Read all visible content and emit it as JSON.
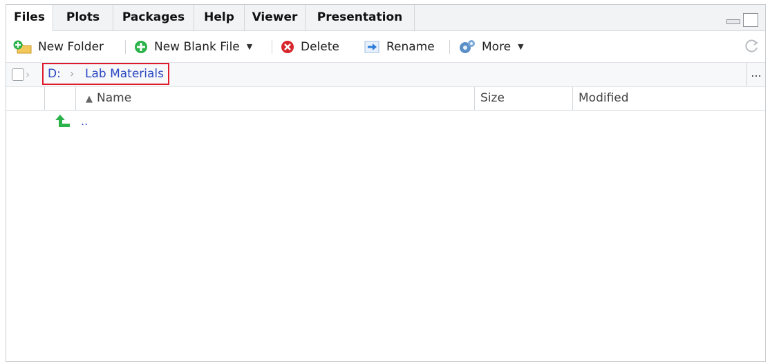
{
  "tabs": [
    {
      "label": "Files",
      "active": true
    },
    {
      "label": "Plots"
    },
    {
      "label": "Packages"
    },
    {
      "label": "Help"
    },
    {
      "label": "Viewer"
    },
    {
      "label": "Presentation"
    }
  ],
  "toolbar": {
    "new_folder": "New Folder",
    "new_blank_file": "New Blank File",
    "delete": "Delete",
    "rename": "Rename",
    "more": "More"
  },
  "breadcrumb": {
    "items": [
      "D:",
      "Lab Materials"
    ],
    "more": "..."
  },
  "table": {
    "columns": [
      "Name",
      "Size",
      "Modified"
    ],
    "rows": [
      {
        "name": ".."
      }
    ]
  },
  "colors": {
    "link": "#2c49c3",
    "highlight_border": "#e0192c",
    "up_arrow": "#2bb34a"
  }
}
